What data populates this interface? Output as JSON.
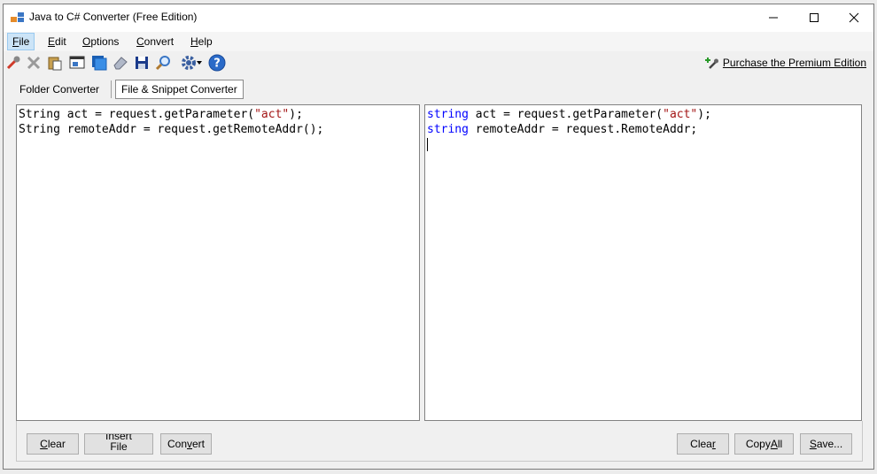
{
  "window": {
    "title": "Java to C# Converter (Free Edition)"
  },
  "menu": {
    "items": [
      {
        "label": "File",
        "mnemonic": "F",
        "rest": "ile"
      },
      {
        "label": "Edit",
        "mnemonic": "E",
        "rest": "dit"
      },
      {
        "label": "Options",
        "mnemonic": "O",
        "rest": "ptions"
      },
      {
        "label": "Convert",
        "mnemonic": "C",
        "rest": "onvert"
      },
      {
        "label": "Help",
        "mnemonic": "H",
        "rest": "elp"
      }
    ]
  },
  "toolbar": {
    "icons": [
      "wrench-icon",
      "delete-icon",
      "paste-icon",
      "window-icon",
      "copy-icon",
      "eraser-icon",
      "save-icon",
      "search-icon",
      "settings-icon",
      "help-icon"
    ],
    "premium_label": "Purchase the Premium Edition"
  },
  "tabs": [
    {
      "label": "Folder Converter",
      "selected": false
    },
    {
      "label": "File & Snippet Converter",
      "selected": true
    }
  ],
  "java_pane": {
    "lines": [
      {
        "pre": "String act = request.getParameter(",
        "str": "\"act\"",
        "post": ");"
      },
      {
        "pre": "String remoteAddr = request.getRemoteAddr();",
        "str": "",
        "post": ""
      }
    ]
  },
  "csharp_pane": {
    "lines": [
      {
        "kw": "string",
        "pre": " act = request.getParameter(",
        "str": "\"act\"",
        "post": ");"
      },
      {
        "kw": "string",
        "pre": " remoteAddr = request.RemoteAddr;",
        "str": "",
        "post": ""
      }
    ]
  },
  "left_buttons": {
    "clear": {
      "mn": "C",
      "rest": "lear"
    },
    "insert_file_line1": "Insert",
    "insert_file_line2": "File",
    "convert": {
      "pre": "Con",
      "mn": "v",
      "rest": "ert"
    }
  },
  "right_buttons": {
    "clear": {
      "pre": "Clea",
      "mn": "r",
      "rest": ""
    },
    "copy_all": {
      "pre": "Copy ",
      "mn": "A",
      "rest": "ll"
    },
    "save": {
      "pre": "",
      "mn": "S",
      "rest": "ave..."
    }
  },
  "colors": {
    "keyword": "#0000ff",
    "string": "#a31515",
    "menu_active": "#cce4f7"
  }
}
